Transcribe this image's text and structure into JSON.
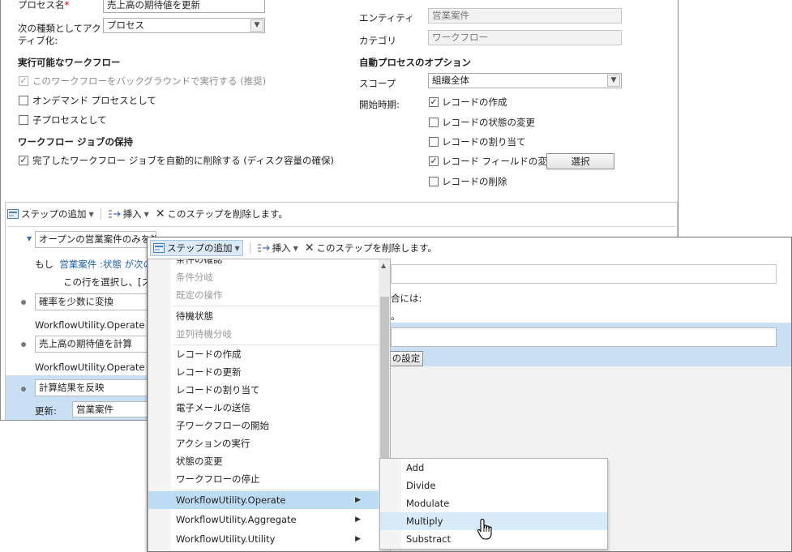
{
  "form": {
    "process_name_label": "プロセス名",
    "required_mark": "*",
    "process_name_value": "売上高の期待値を更新",
    "activate_as_label_line1": "次の種類としてアク",
    "activate_as_label_line2": "ティブ化:",
    "activate_as_value": "プロセス",
    "entity_label": "エンティティ",
    "entity_value": "営業案件",
    "category_label": "カテゴリ",
    "category_value": "ワークフロー"
  },
  "available": {
    "heading": "実行可能なワークフロー",
    "background": "このワークフローをバックグラウンドで実行する (推奨)",
    "on_demand": "オンデマンド プロセスとして",
    "child": "子プロセスとして"
  },
  "job_retention": {
    "heading": "ワークフロー ジョブの保持",
    "auto_delete": "完了したワークフロー ジョブを自動的に削除する (ディスク容量の確保)"
  },
  "options": {
    "heading": "自動プロセスのオプション",
    "scope_label": "スコープ",
    "scope_value": "組織全体",
    "start_when_label": "開始時期:",
    "record_created": "レコードの作成",
    "status_changed": "レコードの状態の変更",
    "assigned": "レコードの割り当て",
    "fields_changed": "レコード フィールドの変更",
    "select_button": "選択",
    "deleted": "レコードの削除"
  },
  "toolbar": {
    "add_step": "ステップの追加",
    "insert": "挿入",
    "delete": "このステップを削除します。"
  },
  "steps": {
    "condition_text": "オープンの営業案件のみを処",
    "if_prefix": "もし",
    "if_entity": "営業案件",
    "if_field": ":状態",
    "if_rest": "が次の",
    "select_row_hint": "この行を選択し、[ステ",
    "step1_name": "確率を少数に変換",
    "step1_action": "WorkflowUtility.Operate",
    "step2_name": "売上高の期待値を計算",
    "step2_action": "WorkflowUtility.Operate",
    "step3_name": "計算結果を反映",
    "update_label": "更新:",
    "update_value": "営業案件"
  },
  "front": {
    "condition_suffix": "合には:",
    "period": "。",
    "set_props_button": "の設定"
  },
  "menu": {
    "items": [
      {
        "label": "条件の確認",
        "disabled": false
      },
      {
        "label": "条件分岐",
        "disabled": true
      },
      {
        "label": "既定の操作",
        "disabled": true
      },
      {
        "label": "待機状態",
        "disabled": false
      },
      {
        "label": "並列待機分岐",
        "disabled": true
      },
      {
        "label": "レコードの作成",
        "disabled": false
      },
      {
        "label": "レコードの更新",
        "disabled": false
      },
      {
        "label": "レコードの割り当て",
        "disabled": false
      },
      {
        "label": "電子メールの送信",
        "disabled": false
      },
      {
        "label": "子ワークフローの開始",
        "disabled": false
      },
      {
        "label": "アクションの実行",
        "disabled": false
      },
      {
        "label": "状態の変更",
        "disabled": false
      },
      {
        "label": "ワークフローの停止",
        "disabled": false
      },
      {
        "label": "WorkflowUtility.Operate",
        "disabled": false
      },
      {
        "label": "WorkflowUtility.Aggregate",
        "disabled": false
      },
      {
        "label": "WorkflowUtility.Utility",
        "disabled": false
      }
    ]
  },
  "submenu": {
    "items": [
      "Add",
      "Divide",
      "Modulate",
      "Multiply",
      "Substract"
    ]
  },
  "colors": {
    "highlight": "#bcdcf4",
    "selected_row": "#c8dff4",
    "link": "#1f5fa8"
  }
}
